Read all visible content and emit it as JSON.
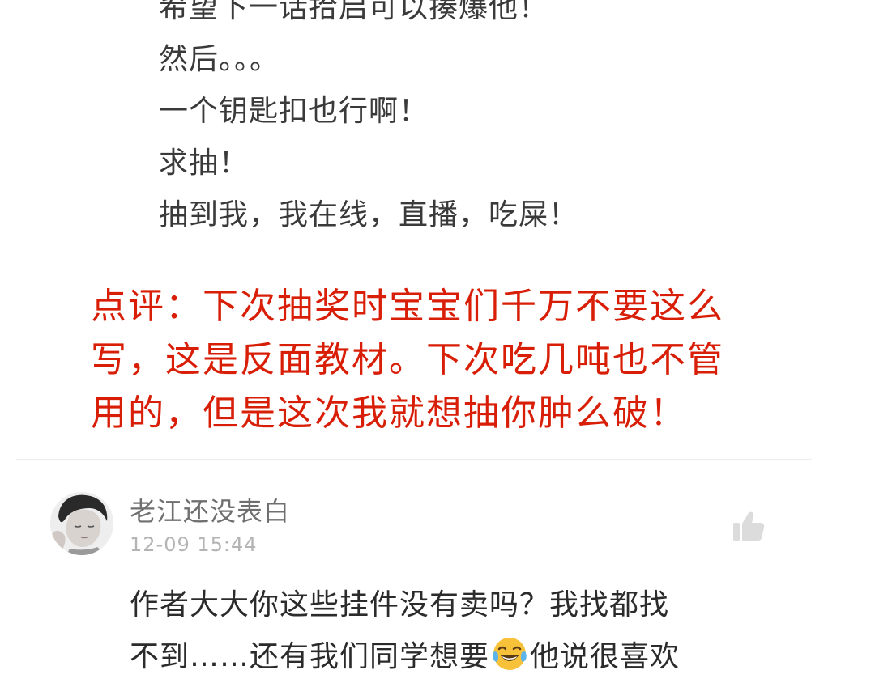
{
  "previous_comment": {
    "lines": [
      "希望下一话拾启可以揍爆他！",
      "然后。。。",
      "一个钥匙扣也行啊！",
      "求抽！",
      "抽到我，我在线，直播，吃屎！"
    ]
  },
  "editor_note": {
    "lines": [
      "点评：下次抽奖时宝宝们千万不要这么",
      "写，这是反面教材。下次吃几吨也不管",
      "用的，但是这次我就想抽你肿么破！"
    ],
    "color": "#d81e06"
  },
  "comment": {
    "username": "老江还没表白",
    "timestamp": "12-09 15:44",
    "avatar_icon": "user-avatar",
    "like_icon": "thumbs-up-icon",
    "body": {
      "line1": "作者大大你这些挂件没有卖吗？我找都找",
      "line2_before": "不到……还有我们同学想要",
      "emoji": "tears-of-joy-emoji",
      "line2_after": "他说很喜欢"
    }
  }
}
